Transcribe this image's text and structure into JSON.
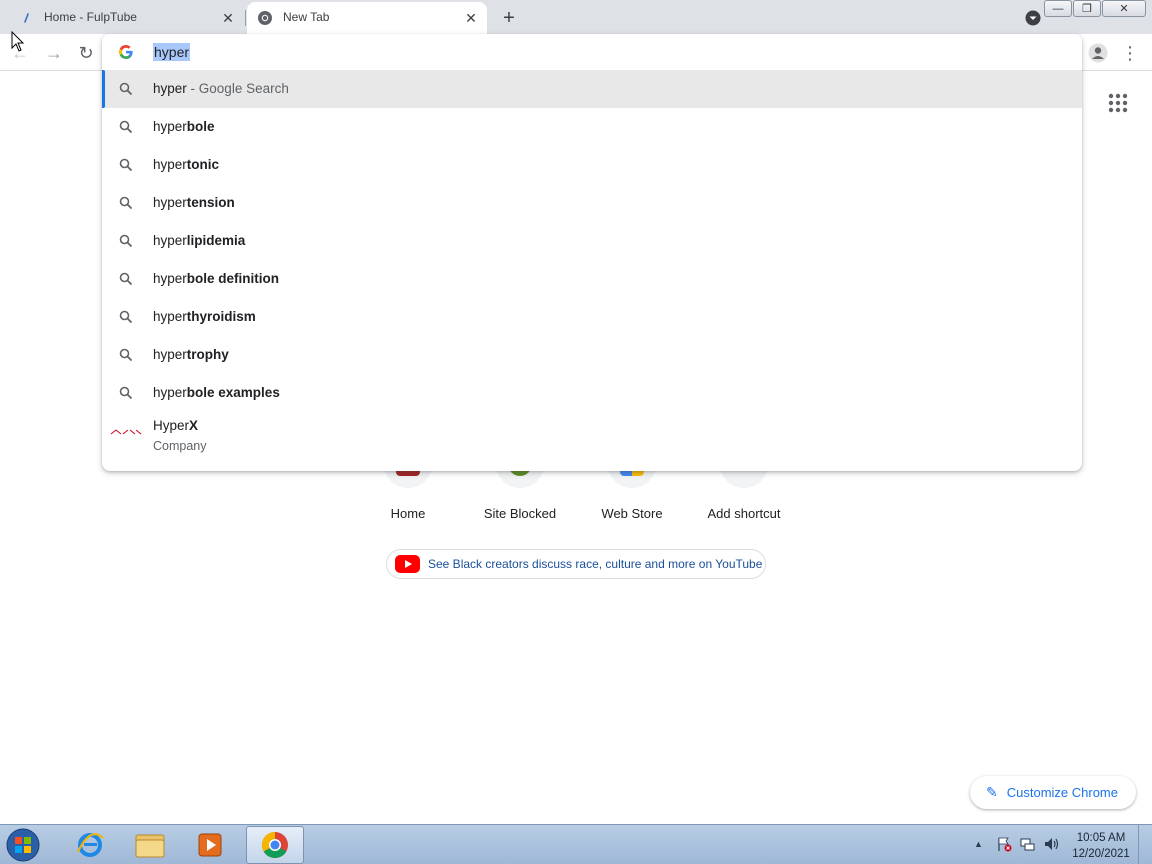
{
  "tabs": [
    {
      "title": "Home - FulpTube",
      "active": false
    },
    {
      "title": "New Tab",
      "active": true
    }
  ],
  "tabstrip": {
    "new_tab_symbol": "+",
    "close_symbol": "✕"
  },
  "window_controls": {
    "minimize": "—",
    "restore": "❐",
    "close": "✕"
  },
  "toolbar": {
    "back": "←",
    "forward": "→",
    "reload": "↻",
    "menu": "⋮"
  },
  "omnibox": {
    "input_value": "hyper",
    "suggestions": [
      {
        "typed": "hyper",
        "completion": "",
        "description": "- Google Search",
        "selected": true
      },
      {
        "typed": "hyper",
        "completion": "bole"
      },
      {
        "typed": "hyper",
        "completion": "tonic"
      },
      {
        "typed": "hyper",
        "completion": "tension"
      },
      {
        "typed": "hyper",
        "completion": "lipidemia"
      },
      {
        "typed": "hyper",
        "completion": "bole definition"
      },
      {
        "typed": "hyper",
        "completion": "thyroidism"
      },
      {
        "typed": "hyper",
        "completion": "trophy"
      },
      {
        "typed": "hyper",
        "completion": "bole examples"
      }
    ],
    "entity": {
      "typed": "Hyper",
      "completion": "X",
      "subtitle": "Company"
    }
  },
  "ntp": {
    "shortcuts": [
      {
        "label": "Home",
        "color": "#a32424"
      },
      {
        "label": "Site Blocked",
        "color": "#5b8c23"
      },
      {
        "label": "Web Store",
        "color": "#4285f4"
      },
      {
        "label": "Add shortcut",
        "color": "#5f6368"
      }
    ],
    "promo_text": "See Black creators discuss race, culture and more on YouTube",
    "customize_label": "Customize Chrome",
    "customize_icon": "✎"
  },
  "taskbar": {
    "apps": [
      "start-orb",
      "internet-explorer",
      "file-explorer",
      "media-player",
      "chrome"
    ],
    "active_app": "chrome",
    "clock_time": "10:05 AM",
    "clock_date": "12/20/2021",
    "tray_arrow": "▲"
  },
  "colors": {
    "accent": "#1a73e8",
    "selection": "#a8c7fa",
    "tabstrip": "#dee1e6"
  }
}
